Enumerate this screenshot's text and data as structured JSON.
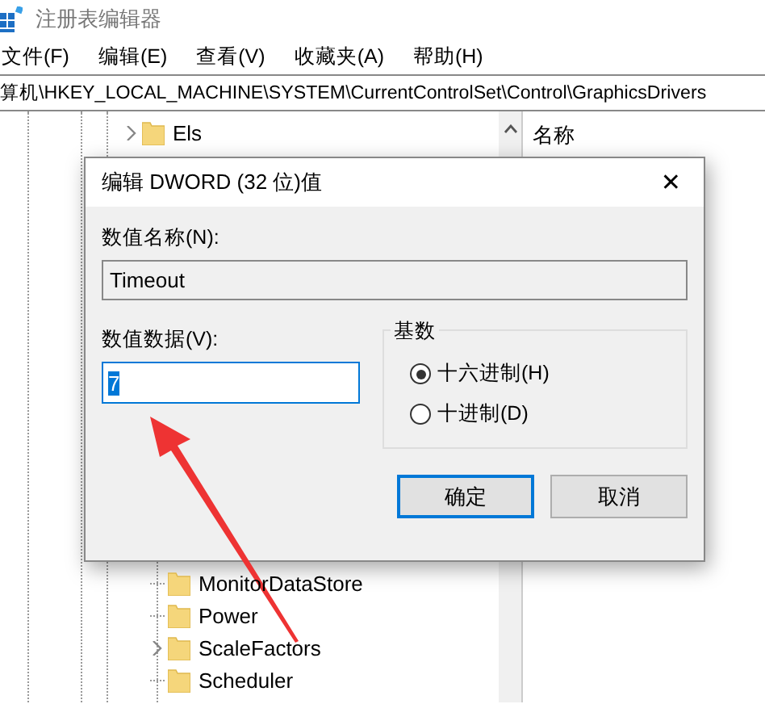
{
  "window": {
    "title": "注册表编辑器"
  },
  "menu": [
    {
      "label": "文件(F)"
    },
    {
      "label": "编辑(E)"
    },
    {
      "label": "查看(V)"
    },
    {
      "label": "收藏夹(A)"
    },
    {
      "label": "帮助(H)"
    }
  ],
  "address": "算机\\HKEY_LOCAL_MACHINE\\SYSTEM\\CurrentControlSet\\Control\\GraphicsDrivers",
  "tree": [
    {
      "label": "Els",
      "expandable": true
    },
    {
      "children": [
        {
          "label": "MonitorDataStore",
          "expandable": false
        },
        {
          "label": "Power",
          "expandable": false
        },
        {
          "label": "ScaleFactors",
          "expandable": true
        },
        {
          "label": "Scheduler",
          "expandable": false
        }
      ]
    }
  ],
  "list_header": "名称",
  "dialog": {
    "title": "编辑 DWORD (32 位)值",
    "close": "✕",
    "name_label": "数值名称(N):",
    "name_value": "Timeout",
    "data_label": "数值数据(V):",
    "data_value": "7",
    "base_label": "基数",
    "radios": [
      {
        "label": "十六进制(H)",
        "selected": true
      },
      {
        "label": "十进制(D)",
        "selected": false
      }
    ],
    "buttons": [
      {
        "label": "确定",
        "default": true
      },
      {
        "label": "取消",
        "default": false
      }
    ]
  }
}
